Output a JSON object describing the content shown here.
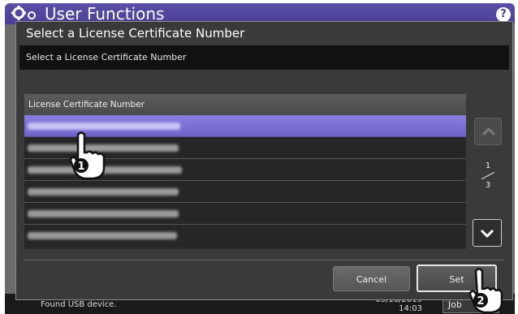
{
  "app": {
    "title": "User Functions",
    "help_label": "?"
  },
  "status_bar": {
    "message": "Found USB device.",
    "date": "05/16/2019",
    "time": "14:03",
    "job_label": "Job"
  },
  "dialog": {
    "title": "Select a License Certificate Number",
    "instruction": "Select a License Certificate Number",
    "list": {
      "header": "License Certificate Number",
      "rows": [
        {
          "selected": true
        },
        {
          "selected": false
        },
        {
          "selected": false
        },
        {
          "selected": false
        },
        {
          "selected": false
        },
        {
          "selected": false
        }
      ]
    },
    "pager": {
      "current": "1",
      "total": "3"
    },
    "buttons": {
      "cancel": "Cancel",
      "set": "Set"
    }
  },
  "annotations": {
    "step1": "1",
    "step2": "2"
  },
  "colors": {
    "accent": "#6e62c8",
    "header": "#4a3f95",
    "dialog_bg": "#3a3a3a"
  }
}
